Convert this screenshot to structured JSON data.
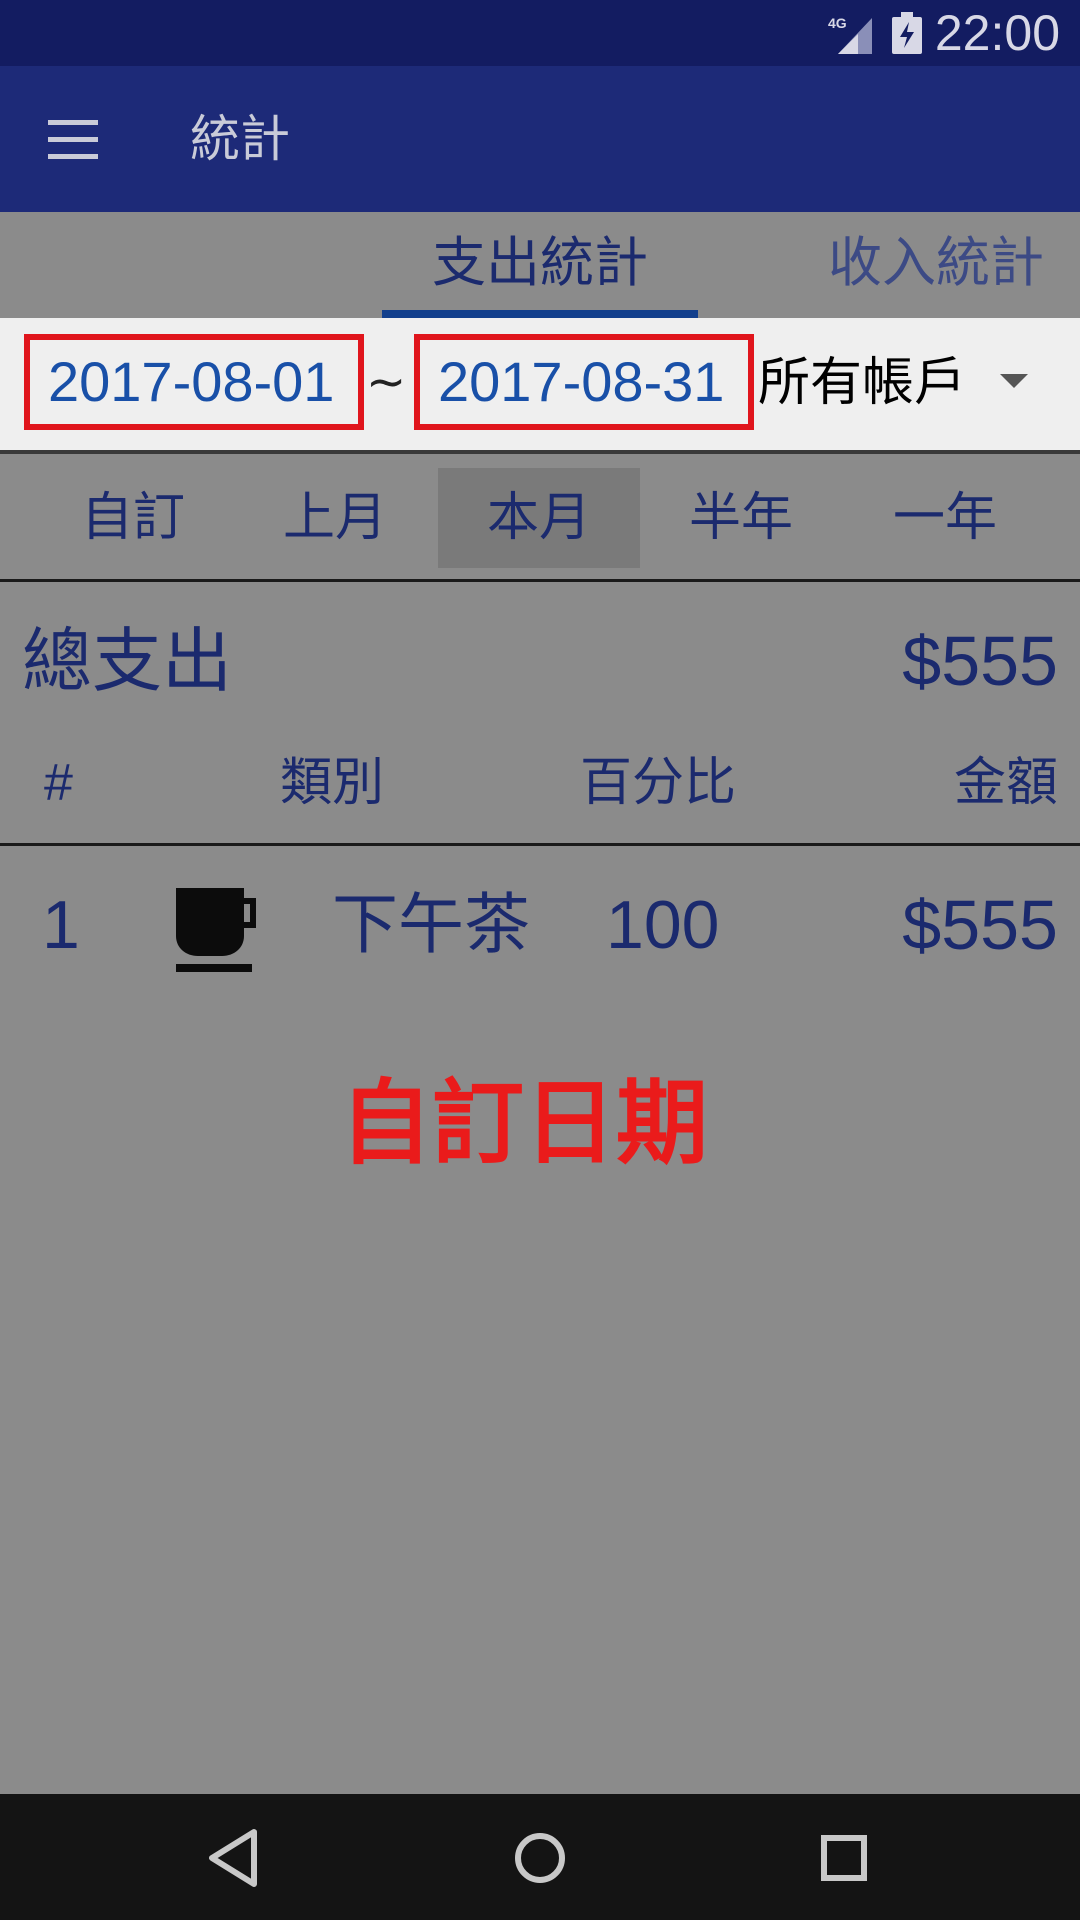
{
  "status_bar": {
    "network_label": "4G",
    "time": "22:00",
    "signal_icon": "cellular-signal-icon",
    "battery_icon": "battery-charging-icon"
  },
  "app_bar": {
    "menu_icon": "hamburger-menu-icon",
    "title": "統計"
  },
  "tabs": [
    {
      "label": "支出統計",
      "selected": true
    },
    {
      "label": "收入統計",
      "selected": false
    }
  ],
  "filter": {
    "start_date": "2017-08-01",
    "separator": "~",
    "end_date": "2017-08-31",
    "account": "所有帳戶",
    "account_icon": "dropdown-arrow-icon"
  },
  "ranges": [
    {
      "label": "自訂",
      "selected": false
    },
    {
      "label": "上月",
      "selected": false
    },
    {
      "label": "本月",
      "selected": true
    },
    {
      "label": "半年",
      "selected": false
    },
    {
      "label": "一年",
      "selected": false
    }
  ],
  "summary": {
    "label": "總支出",
    "total": "$555"
  },
  "table": {
    "headers": {
      "num": "#",
      "category": "類別",
      "percent": "百分比",
      "amount": "金額"
    },
    "rows": [
      {
        "num": "1",
        "icon": "coffee-cup-icon",
        "category": "下午茶",
        "percent": "100",
        "amount": "$555"
      }
    ]
  },
  "annotation": "自訂日期",
  "colors": {
    "status_bar": "#131c61",
    "app_bar": "#1d2a78",
    "accent_text": "#1b2a6e",
    "date_text": "#1950a8",
    "highlight_red": "#e0151c",
    "overlay_gray": "#8b8b8b"
  },
  "nav_bar": {
    "back_icon": "back-triangle-icon",
    "home_icon": "home-circle-icon",
    "recents_icon": "recents-square-icon"
  }
}
